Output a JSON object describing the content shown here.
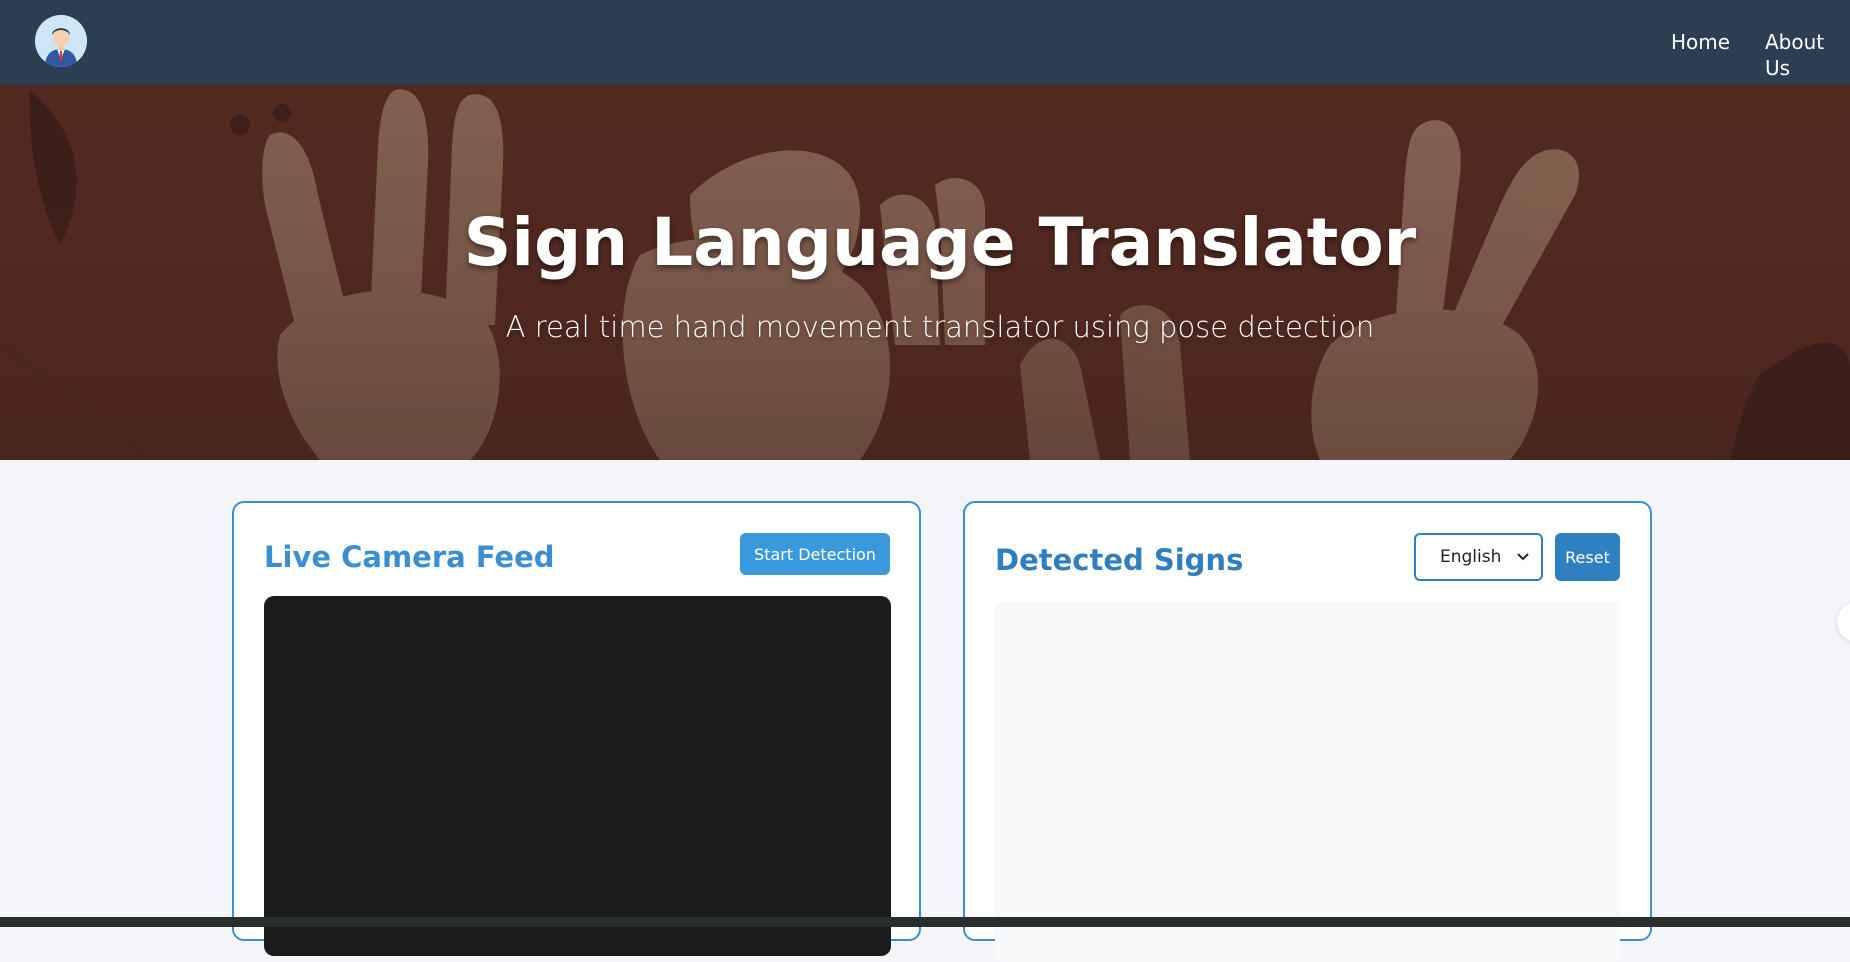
{
  "nav": {
    "avatar_icon": "user-avatar-icon",
    "links": [
      {
        "label": "Home"
      },
      {
        "label": "About Us"
      }
    ]
  },
  "hero": {
    "title": "Sign Language Translator",
    "subtitle": "A real time hand movement translator using pose detection"
  },
  "camera_panel": {
    "title": "Live Camera Feed",
    "start_label": "Start Detection"
  },
  "signs_panel": {
    "title": "Detected Signs",
    "language": {
      "selected": "English"
    },
    "reset_label": "Reset"
  },
  "colors": {
    "nav_bg": "#2c3e52",
    "hero_bg": "#4f2a26",
    "accent": "#3a8fd3",
    "camera_bg": "#1b1b1b"
  }
}
